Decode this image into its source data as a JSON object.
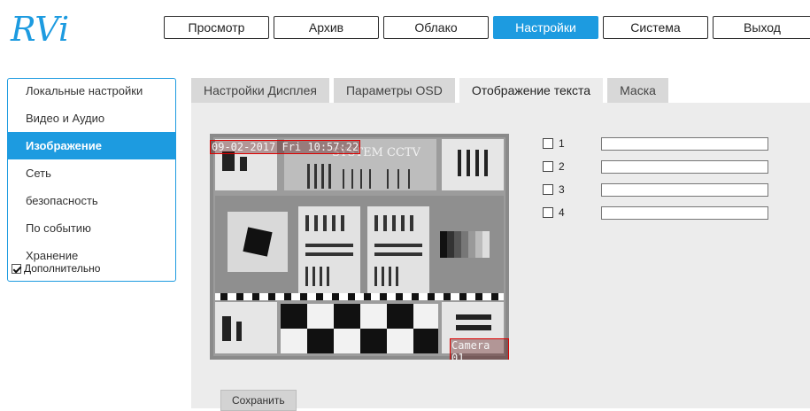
{
  "logo": {
    "text": "RVi"
  },
  "nav": {
    "items": [
      "Просмотр",
      "Архив",
      "Облако",
      "Настройки",
      "Система",
      "Выход"
    ],
    "active": "Настройки"
  },
  "sidebar": {
    "items": [
      "Локальные настройки",
      "Видео и Аудио",
      "Изображение",
      "Сеть",
      "безопасность",
      "По событию",
      "Хранение"
    ],
    "active": "Изображение",
    "extra": {
      "label": "Дополнительно",
      "checked": true
    }
  },
  "tabs": {
    "items": [
      "Настройки Дисплея",
      "Параметры OSD",
      "Отображение текста",
      "Маска"
    ],
    "active": "Отображение текста"
  },
  "video": {
    "osd_datetime": "09-02-2017 Fri 10:57:22",
    "osd_camera": "Camera 01",
    "chart_label": "SYSTEM CCTV"
  },
  "text_overlays": [
    {
      "label": "1",
      "checked": false,
      "value": ""
    },
    {
      "label": "2",
      "checked": false,
      "value": ""
    },
    {
      "label": "3",
      "checked": false,
      "value": ""
    },
    {
      "label": "4",
      "checked": false,
      "value": ""
    }
  ],
  "save_label": "Сохранить",
  "colors": {
    "accent": "#1d9be0",
    "panel": "#ececec",
    "tab": "#d8d8d8"
  }
}
